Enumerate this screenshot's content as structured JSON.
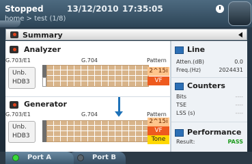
{
  "header": {
    "status": "Stopped",
    "date": "13/12/2010",
    "time": "17:35:05",
    "path": "home > test (1/8)"
  },
  "summary": {
    "title": "Summary"
  },
  "analyzer": {
    "title": "Analyzer",
    "mode": "G.703/E1",
    "framing": "G.704",
    "pattern_label": "Pattern",
    "coding": [
      "Unb.",
      "HDB3"
    ],
    "pattern": "2^15i",
    "vf": "VF"
  },
  "generator": {
    "title": "Generator",
    "mode": "G.703/E1",
    "framing": "G.704",
    "pattern_label": "Pattern",
    "coding": [
      "Unb.",
      "HDB3"
    ],
    "pattern": "2^15i",
    "vf": "VF",
    "tone": "Tone"
  },
  "line": {
    "title": "Line",
    "atten_label": "Atten.(dB)",
    "atten_value": "0.0",
    "freq_label": "Freq.(Hz)",
    "freq_value": "2024431"
  },
  "counters": {
    "title": "Counters",
    "rows": [
      {
        "label": "Bits",
        "value": "----"
      },
      {
        "label": "TSE",
        "value": "----"
      },
      {
        "label": "LSS (s)",
        "value": "----"
      }
    ]
  },
  "performance": {
    "title": "Performance",
    "result_label": "Result:",
    "result_value": "PASS"
  },
  "ports": {
    "a": "Port A",
    "b": "Port B"
  },
  "colors": {
    "accent_blue": "#1e72b8",
    "alarm_red": "#ee5a1e",
    "tone_yellow": "#ffd800",
    "pass_green": "#1d9b1d",
    "led_on": "#39d93b"
  }
}
